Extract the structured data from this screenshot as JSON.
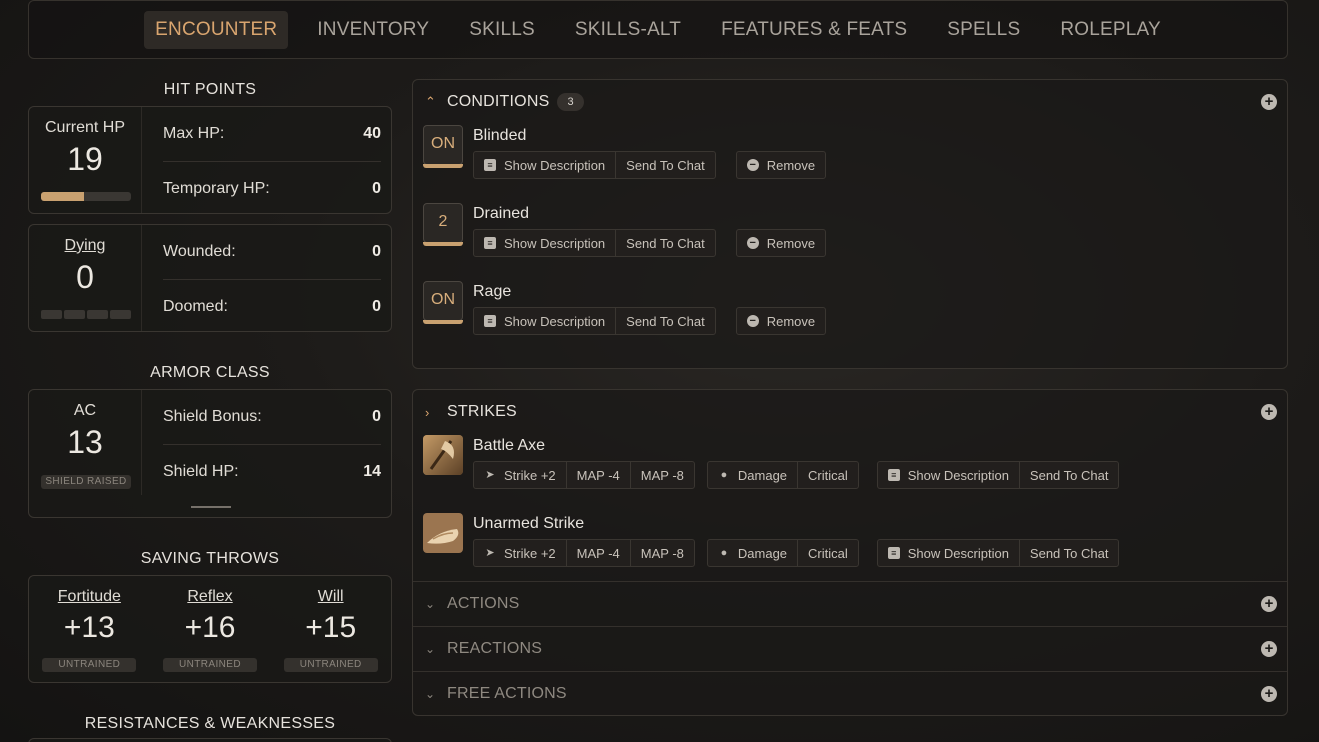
{
  "nav": {
    "tabs": [
      "ENCOUNTER",
      "INVENTORY",
      "SKILLS",
      "SKILLS-ALT",
      "FEATURES & FEATS",
      "SPELLS",
      "ROLEPLAY"
    ],
    "active": "ENCOUNTER"
  },
  "hit_points": {
    "title": "HIT POINTS",
    "current_label": "Current HP",
    "current": "19",
    "hp_fraction": 0.475,
    "max_label": "Max HP:",
    "max": "40",
    "temp_label": "Temporary HP:",
    "temp": "0"
  },
  "dying": {
    "label": "Dying",
    "value": "0",
    "wounded_label": "Wounded:",
    "wounded": "0",
    "doomed_label": "Doomed:",
    "doomed": "0"
  },
  "armor": {
    "title": "ARMOR CLASS",
    "ac_label": "AC",
    "ac": "13",
    "badge": "SHIELD RAISED",
    "shield_bonus_label": "Shield Bonus:",
    "shield_bonus": "0",
    "shield_hp_label": "Shield HP:",
    "shield_hp": "14"
  },
  "saves": {
    "title": "SAVING THROWS",
    "items": [
      {
        "label": "Fortitude",
        "value": "+13",
        "rank": "UNTRAINED"
      },
      {
        "label": "Reflex",
        "value": "+16",
        "rank": "UNTRAINED"
      },
      {
        "label": "Will",
        "value": "+15",
        "rank": "UNTRAINED"
      }
    ]
  },
  "resist": {
    "title": "RESISTANCES & WEAKNESSES"
  },
  "conditions": {
    "title": "CONDITIONS",
    "count": "3",
    "show_desc": "Show Description",
    "send_chat": "Send To Chat",
    "remove": "Remove",
    "items": [
      {
        "badge": "ON",
        "name": "Blinded"
      },
      {
        "badge": "2",
        "name": "Drained"
      },
      {
        "badge": "ON",
        "name": "Rage"
      }
    ]
  },
  "strikes": {
    "title": "STRIKES",
    "strike": "Strike +2",
    "map1": "MAP -4",
    "map2": "MAP -8",
    "damage": "Damage",
    "critical": "Critical",
    "show_desc": "Show Description",
    "send_chat": "Send To Chat",
    "items": [
      {
        "name": "Battle Axe",
        "icon": "battle-axe-icon"
      },
      {
        "name": "Unarmed Strike",
        "icon": "fist-icon"
      }
    ]
  },
  "sections": {
    "actions": "ACTIONS",
    "reactions": "REACTIONS",
    "free_actions": "FREE ACTIONS"
  },
  "colors": {
    "accent": "#d9a56f",
    "hp_fill": "#c9a170"
  }
}
